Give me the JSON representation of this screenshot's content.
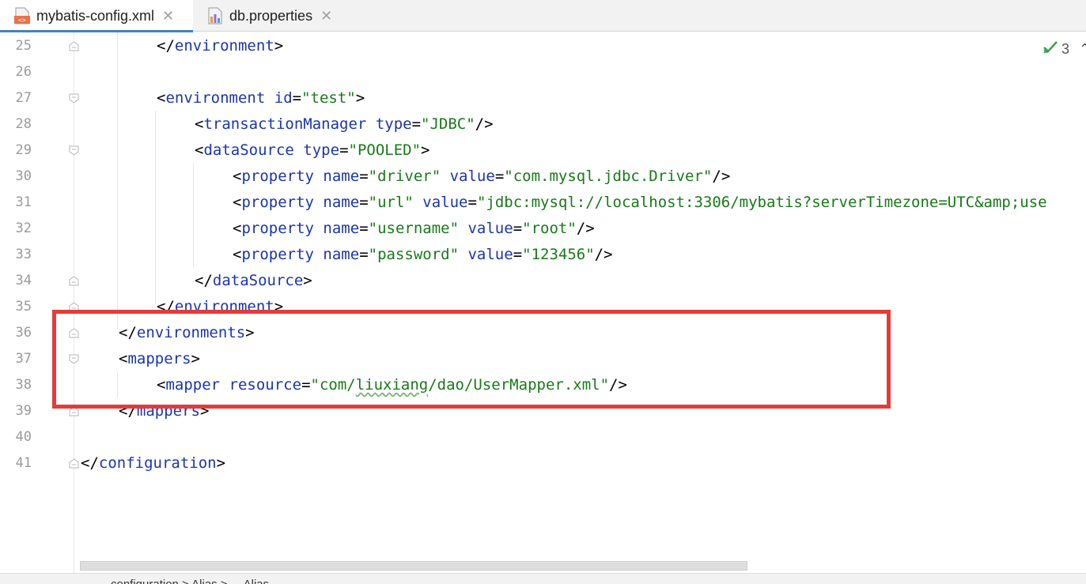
{
  "tabs": [
    {
      "label": "mybatis-config.xml",
      "icon": "xml-file-icon",
      "active": true
    },
    {
      "label": "db.properties",
      "icon": "properties-file-icon",
      "active": false
    }
  ],
  "inspection": {
    "count": "3",
    "icon": "check-icon"
  },
  "lines": [
    {
      "num": "25",
      "indent": 2,
      "tokens": [
        [
          "p",
          "</"
        ],
        [
          "tag",
          "environment"
        ],
        [
          "p",
          ">"
        ]
      ]
    },
    {
      "num": "26",
      "indent": 0,
      "tokens": []
    },
    {
      "num": "27",
      "indent": 2,
      "tokens": [
        [
          "p",
          "<"
        ],
        [
          "tag",
          "environment"
        ],
        [
          "p",
          " "
        ],
        [
          "attr",
          "id"
        ],
        [
          "p",
          "="
        ],
        [
          "val",
          "\"test\""
        ],
        [
          "p",
          ">"
        ]
      ]
    },
    {
      "num": "28",
      "indent": 3,
      "tokens": [
        [
          "p",
          "<"
        ],
        [
          "tag",
          "transactionManager"
        ],
        [
          "p",
          " "
        ],
        [
          "attr",
          "type"
        ],
        [
          "p",
          "="
        ],
        [
          "val",
          "\"JDBC\""
        ],
        [
          "p",
          "/>"
        ]
      ]
    },
    {
      "num": "29",
      "indent": 3,
      "tokens": [
        [
          "p",
          "<"
        ],
        [
          "tag",
          "dataSource"
        ],
        [
          "p",
          " "
        ],
        [
          "attr",
          "type"
        ],
        [
          "p",
          "="
        ],
        [
          "val",
          "\"POOLED\""
        ],
        [
          "p",
          ">"
        ]
      ]
    },
    {
      "num": "30",
      "indent": 4,
      "tokens": [
        [
          "p",
          "<"
        ],
        [
          "tag",
          "property"
        ],
        [
          "p",
          " "
        ],
        [
          "attr",
          "name"
        ],
        [
          "p",
          "="
        ],
        [
          "val",
          "\"driver\""
        ],
        [
          "p",
          " "
        ],
        [
          "attr",
          "value"
        ],
        [
          "p",
          "="
        ],
        [
          "val",
          "\"com.mysql.jdbc.Driver\""
        ],
        [
          "p",
          "/>"
        ]
      ]
    },
    {
      "num": "31",
      "indent": 4,
      "tokens": [
        [
          "p",
          "<"
        ],
        [
          "tag",
          "property"
        ],
        [
          "p",
          " "
        ],
        [
          "attr",
          "name"
        ],
        [
          "p",
          "="
        ],
        [
          "val",
          "\"url\""
        ],
        [
          "p",
          " "
        ],
        [
          "attr",
          "value"
        ],
        [
          "p",
          "="
        ],
        [
          "val",
          "\"jdbc:mysql://localhost:3306/mybatis?serverTimezone=UTC&amp;use"
        ]
      ]
    },
    {
      "num": "32",
      "indent": 4,
      "tokens": [
        [
          "p",
          "<"
        ],
        [
          "tag",
          "property"
        ],
        [
          "p",
          " "
        ],
        [
          "attr",
          "name"
        ],
        [
          "p",
          "="
        ],
        [
          "val",
          "\"username\""
        ],
        [
          "p",
          " "
        ],
        [
          "attr",
          "value"
        ],
        [
          "p",
          "="
        ],
        [
          "val",
          "\"root\""
        ],
        [
          "p",
          "/>"
        ]
      ]
    },
    {
      "num": "33",
      "indent": 4,
      "tokens": [
        [
          "p",
          "<"
        ],
        [
          "tag",
          "property"
        ],
        [
          "p",
          " "
        ],
        [
          "attr",
          "name"
        ],
        [
          "p",
          "="
        ],
        [
          "val",
          "\"password\""
        ],
        [
          "p",
          " "
        ],
        [
          "attr",
          "value"
        ],
        [
          "p",
          "="
        ],
        [
          "val",
          "\"123456\""
        ],
        [
          "p",
          "/>"
        ]
      ]
    },
    {
      "num": "34",
      "indent": 3,
      "tokens": [
        [
          "p",
          "</"
        ],
        [
          "tag",
          "dataSource"
        ],
        [
          "p",
          ">"
        ]
      ]
    },
    {
      "num": "35",
      "indent": 2,
      "tokens": [
        [
          "p",
          "</"
        ],
        [
          "tag",
          "environment"
        ],
        [
          "p",
          ">"
        ]
      ]
    },
    {
      "num": "36",
      "indent": 1,
      "tokens": [
        [
          "p",
          "</"
        ],
        [
          "tag",
          "environments"
        ],
        [
          "p",
          ">"
        ]
      ]
    },
    {
      "num": "37",
      "indent": 1,
      "tokens": [
        [
          "p",
          "<"
        ],
        [
          "tag",
          "mappers"
        ],
        [
          "p",
          ">"
        ]
      ]
    },
    {
      "num": "38",
      "indent": 2,
      "tokens": [
        [
          "p",
          "<"
        ],
        [
          "tag",
          "mapper"
        ],
        [
          "p",
          " "
        ],
        [
          "attr",
          "resource"
        ],
        [
          "p",
          "="
        ],
        [
          "val",
          "\"com/"
        ],
        [
          "valsq",
          "liuxiang"
        ],
        [
          "val",
          "/dao/UserMapper.xml\""
        ],
        [
          "p",
          "/>"
        ]
      ]
    },
    {
      "num": "39",
      "indent": 1,
      "tokens": [
        [
          "p",
          "</"
        ],
        [
          "tag",
          "mappers"
        ],
        [
          "p",
          ">"
        ]
      ]
    },
    {
      "num": "40",
      "indent": 0,
      "tokens": []
    },
    {
      "num": "41",
      "indent": 0,
      "tokens": [
        [
          "p",
          "</"
        ],
        [
          "tag",
          "configuration"
        ],
        [
          "p",
          ">"
        ]
      ]
    }
  ],
  "breadcrumb": "configuration  >  Alias  >  ...  Alias"
}
